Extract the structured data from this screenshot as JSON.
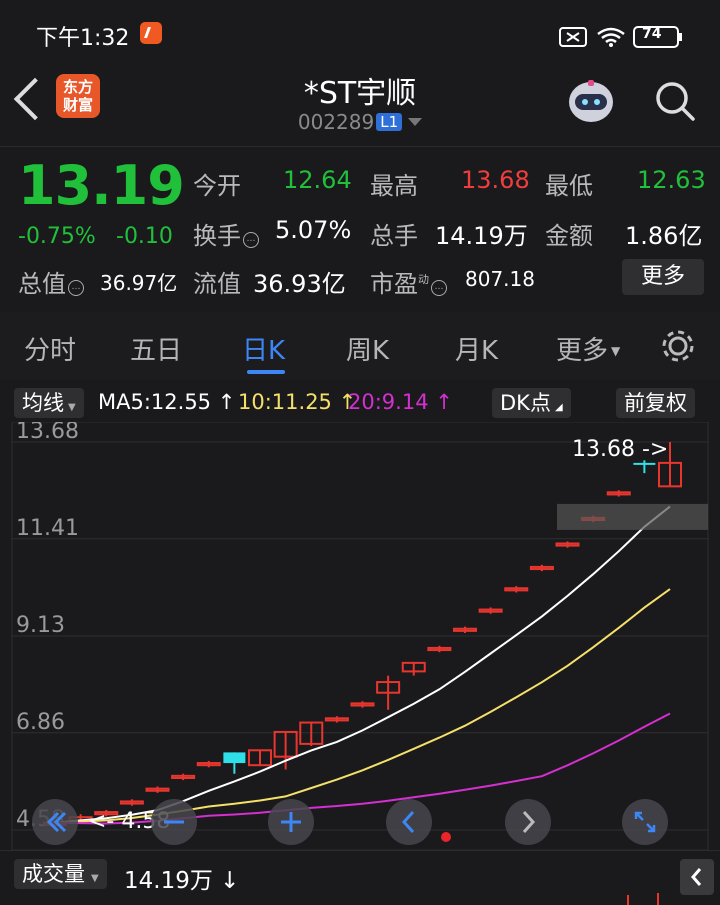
{
  "status_bar": {
    "time": "下午1:32",
    "battery": "74"
  },
  "header": {
    "title": "*ST宇顺",
    "code": "002289",
    "level": "L1",
    "logo_line1": "东方",
    "logo_line2": "财富"
  },
  "quote": {
    "price": "13.19",
    "change_pct": "-0.75%",
    "change": "-0.10",
    "open_label": "今开",
    "open": "12.64",
    "high_label": "最高",
    "high": "13.68",
    "low_label": "最低",
    "low": "12.63",
    "turnover_label": "换手",
    "turnover": "5.07%",
    "volume_label": "总手",
    "volume": "14.19万",
    "amount_label": "金额",
    "amount": "1.86亿",
    "mcap_label": "总值",
    "mcap": "36.97亿",
    "float_label": "流值",
    "float_cap": "36.93亿",
    "pe_label": "市盈",
    "pe_sup": "动",
    "pe": "807.18",
    "more_label": "更多"
  },
  "tabs": [
    "分时",
    "五日",
    "日K",
    "周K",
    "月K",
    "更多"
  ],
  "ma_row": {
    "selector": "均线",
    "ma5": "MA5:12.55",
    "ma10": "10:11.25",
    "ma20": "20:9.14",
    "dk": "DK点",
    "adjust": "前复权"
  },
  "chart_data": {
    "type": "candlestick",
    "y_ticks": [
      "13.68",
      "11.41",
      "9.13",
      "6.86",
      "4.58"
    ],
    "ylim": [
      4.58,
      13.68
    ],
    "max_label": "13.68",
    "min_label": "4.58",
    "candles": [
      {
        "o": 4.7,
        "c": 4.75,
        "h": 4.8,
        "l": 4.62
      },
      {
        "o": 4.8,
        "c": 4.88,
        "h": 4.95,
        "l": 4.78
      },
      {
        "o": 4.95,
        "c": 5.0,
        "h": 5.05,
        "l": 4.9
      },
      {
        "o": 5.2,
        "c": 5.25,
        "h": 5.3,
        "l": 5.15
      },
      {
        "o": 5.5,
        "c": 5.55,
        "h": 5.6,
        "l": 5.45
      },
      {
        "o": 5.8,
        "c": 5.85,
        "h": 5.9,
        "l": 5.75
      },
      {
        "o": 6.1,
        "c": 6.15,
        "h": 6.2,
        "l": 6.05
      },
      {
        "o": 6.4,
        "c": 6.15,
        "h": 6.4,
        "l": 5.9
      },
      {
        "o": 6.1,
        "c": 6.45,
        "h": 6.45,
        "l": 6.1
      },
      {
        "o": 6.3,
        "c": 6.88,
        "h": 6.88,
        "l": 6.0
      },
      {
        "o": 6.6,
        "c": 7.1,
        "h": 7.1,
        "l": 6.55
      },
      {
        "o": 7.15,
        "c": 7.2,
        "h": 7.25,
        "l": 7.1
      },
      {
        "o": 7.5,
        "c": 7.55,
        "h": 7.6,
        "l": 7.45
      },
      {
        "o": 7.8,
        "c": 8.05,
        "h": 8.2,
        "l": 7.4
      },
      {
        "o": 8.3,
        "c": 8.5,
        "h": 8.5,
        "l": 8.2
      },
      {
        "o": 8.8,
        "c": 8.85,
        "h": 8.9,
        "l": 8.75
      },
      {
        "o": 9.25,
        "c": 9.3,
        "h": 9.35,
        "l": 9.2
      },
      {
        "o": 9.7,
        "c": 9.75,
        "h": 9.8,
        "l": 9.65
      },
      {
        "o": 10.2,
        "c": 10.25,
        "h": 10.3,
        "l": 10.15
      },
      {
        "o": 10.7,
        "c": 10.75,
        "h": 10.8,
        "l": 10.65
      },
      {
        "o": 11.25,
        "c": 11.3,
        "h": 11.35,
        "l": 11.2
      },
      {
        "o": 11.85,
        "c": 11.9,
        "h": 11.95,
        "l": 11.8
      },
      {
        "o": 12.45,
        "c": 12.5,
        "h": 12.55,
        "l": 12.4
      },
      {
        "o": 13.19,
        "c": 13.15,
        "h": 13.25,
        "l": 12.95
      },
      {
        "o": 12.64,
        "c": 13.19,
        "h": 13.68,
        "l": 12.63
      }
    ],
    "ma5_color": "#ffffff",
    "ma10_color": "#f5e06a",
    "ma20_color": "#d42fd0",
    "up_color": "#e8362f",
    "down_color": "#2fe0e8"
  },
  "controls": [
    "rewind-icon",
    "zoom-out-icon",
    "zoom-in-icon",
    "prev-icon",
    "next-icon",
    "expand-icon"
  ],
  "volume_row": {
    "selector": "成交量",
    "value": "14.19万"
  }
}
